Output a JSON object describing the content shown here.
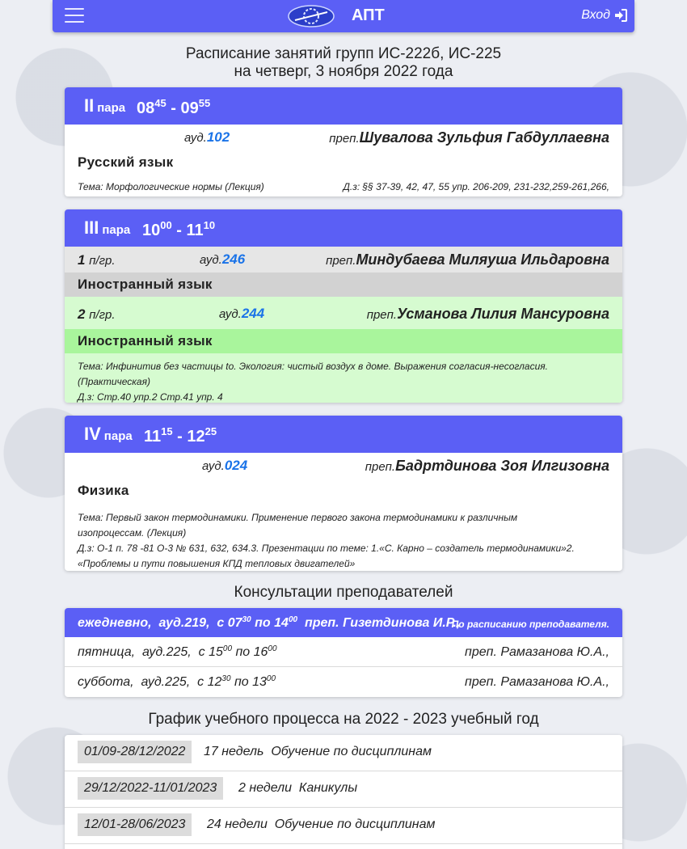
{
  "navbar": {
    "brand": "АПТ",
    "login_label": "Вход",
    "accent": "#5b5ff5"
  },
  "title": {
    "line1": "Расписание занятий групп ИС-222б, ИС-225",
    "line2": "на четверг, 3 ноября 2022 года"
  },
  "lessons": [
    {
      "num": "II",
      "para_label": "пара",
      "start_h": "08",
      "start_m": "45",
      "end_h": "09",
      "end_m": "55",
      "aud_label": "ауд.",
      "aud": "102",
      "prep_label": "преп.",
      "teacher": "Шувалова Зульфия Габдуллаевна",
      "subject": "Русский язык",
      "topic": "Тема: Морфологические нормы (Лекция)",
      "hw": "Д.з: §§ 37-39, 42, 47, 55 упр. 206-209, 231-232,259-261,266,"
    },
    {
      "num": "III",
      "para_label": "пара",
      "start_h": "10",
      "start_m": "00",
      "end_h": "11",
      "end_m": "10",
      "subgroups": [
        {
          "grp_num": "1",
          "grp_label": "п/гр.",
          "aud_label": "ауд.",
          "aud": "246",
          "prep_label": "преп.",
          "teacher": "Миндубаева Миляуша Ильдаровна",
          "subject": "Иностранный язык"
        },
        {
          "grp_num": "2",
          "grp_label": "п/гр.",
          "aud_label": "ауд.",
          "aud": "244",
          "prep_label": "преп.",
          "teacher": "Усманова Лилия Мансуровна",
          "subject": "Иностранный язык"
        }
      ],
      "topic": "Тема: Инфинитив без частицы to. Экология: чистый воздух в доме. Выражения согласия-несогласия.",
      "topic2": "(Практическая)",
      "hw": "Д.з: Стр.40 упр.2 Стр.41 упр. 4"
    },
    {
      "num": "IV",
      "para_label": "пара",
      "start_h": "11",
      "start_m": "15",
      "end_h": "12",
      "end_m": "25",
      "aud_label": "ауд.",
      "aud": "024",
      "prep_label": "преп.",
      "teacher": "Бадртдинова Зоя Илгизовна",
      "subject": "Физика",
      "topic": "Тема: Первый закон термодинамики. Применение первого закона термодинамики к различным",
      "topic2": "изопроцессам. (Лекция)",
      "hw": "Д.з: О-1 п. 78 -81 О-3 № 631, 632, 634.3. Презентации по теме: 1.«С. Карно – создатель термодинамики»2.",
      "hw2": "«Проблемы и пути повышения КПД тепловых двигателей»"
    }
  ],
  "consultations": {
    "title": "Консультации преподавателей",
    "rows": [
      {
        "day": "ежедневно,",
        "aud": "ауд.219,",
        "from_label": "с",
        "from_h": "07",
        "from_m": "30",
        "to_label": "по",
        "to_h": "14",
        "to_m": "00",
        "teacher": "преп. Гизетдинова И.Р.,",
        "note": "По расписанию преподавателя."
      },
      {
        "day": "пятница,",
        "aud": "ауд.225,",
        "from_label": "с",
        "from_h": "15",
        "from_m": "00",
        "to_label": "по",
        "to_h": "16",
        "to_m": "00",
        "teacher": "преп. Рамазанова Ю.А.,"
      },
      {
        "day": "суббота,",
        "aud": "ауд.225,",
        "from_label": "с",
        "from_h": "12",
        "from_m": "30",
        "to_label": "по",
        "to_h": "13",
        "to_m": "00",
        "teacher": "преп. Рамазанова Ю.А.,"
      }
    ]
  },
  "schedule": {
    "title": "График учебного процесса на 2022 - 2023 учебный год",
    "rows": [
      {
        "dates": "01/09-28/12/2022",
        "weeks": "17 недель",
        "activity": "Обучение по дисциплинам"
      },
      {
        "dates": "29/12/2022-11/01/2023",
        "weeks": "2 недели",
        "activity": "Каникулы"
      },
      {
        "dates": "12/01-28/06/2023",
        "weeks": "24 недели",
        "activity": "Обучение по дисциплинам"
      }
    ]
  }
}
